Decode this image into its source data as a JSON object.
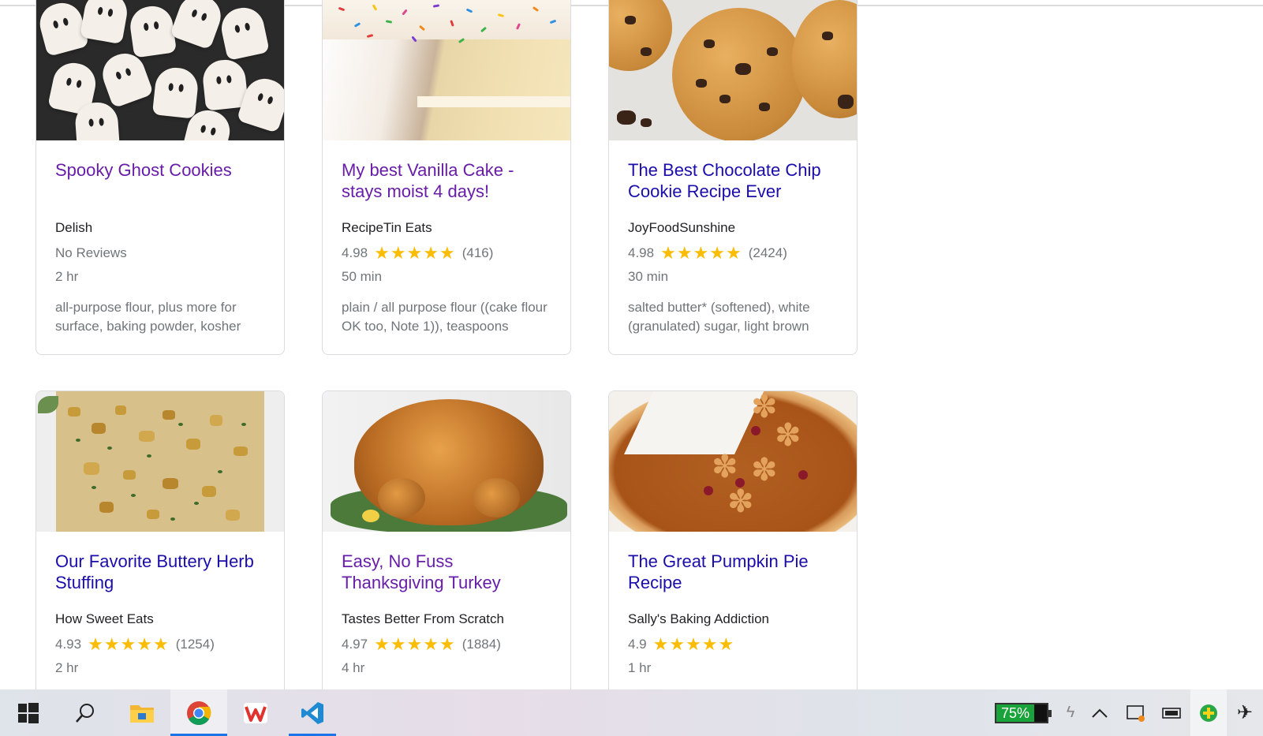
{
  "recipes": [
    {
      "title": "Spooky Ghost Cookies",
      "source": "Delish",
      "rating_text": "No Reviews",
      "time": "2 hr",
      "ingredients": "all-purpose flour, plus more for surface, baking powder, kosher",
      "image": "ghost-cookies-image"
    },
    {
      "title": "My best Vanilla Cake - stays moist 4 days!",
      "source": "RecipeTin Eats",
      "rating": "4.98",
      "stars": "★★★★★",
      "reviews": "(416)",
      "time": "50 min",
      "ingredients": "plain / all purpose flour ((cake flour OK too, Note 1)), teaspoons",
      "image": "vanilla-cake-image"
    },
    {
      "title": "The Best Chocolate Chip Cookie Recipe Ever",
      "source": "JoyFoodSunshine",
      "rating": "4.98",
      "stars": "★★★★★",
      "reviews": "(2424)",
      "time": "30 min",
      "ingredients": "salted butter* (softened), white (granulated) sugar, light brown",
      "image": "chocolate-chip-cookie-image"
    },
    {
      "title": "Our Favorite Buttery Herb Stuffing",
      "source": "How Sweet Eats",
      "rating": "4.93",
      "stars": "★★★★★",
      "reviews": "(1254)",
      "time": "2 hr",
      "image": "herb-stuffing-image"
    },
    {
      "title": "Easy, No Fuss Thanksgiving Turkey",
      "source": "Tastes Better From Scratch",
      "rating": "4.97",
      "stars": "★★★★★",
      "reviews": "(1884)",
      "time": "4 hr",
      "image": "roast-turkey-image"
    },
    {
      "title": "The Great Pumpkin Pie Recipe",
      "source": "Sally's Baking Addiction",
      "rating": "4.9",
      "stars": "★★★★★",
      "reviews": "",
      "time": "1 hr",
      "image": "pumpkin-pie-image"
    }
  ],
  "taskbar": {
    "apps": [
      {
        "name": "start-icon"
      },
      {
        "name": "search-icon"
      },
      {
        "name": "file-explorer-icon"
      },
      {
        "name": "chrome-icon"
      },
      {
        "name": "wps-office-icon"
      },
      {
        "name": "vscode-icon"
      }
    ],
    "battery_percent": "75%"
  },
  "colors": {
    "link": "#1a0dab",
    "visited": "#681da8",
    "star": "#fbbc04",
    "muted": "#70757a",
    "accent": "#1a73e8"
  }
}
